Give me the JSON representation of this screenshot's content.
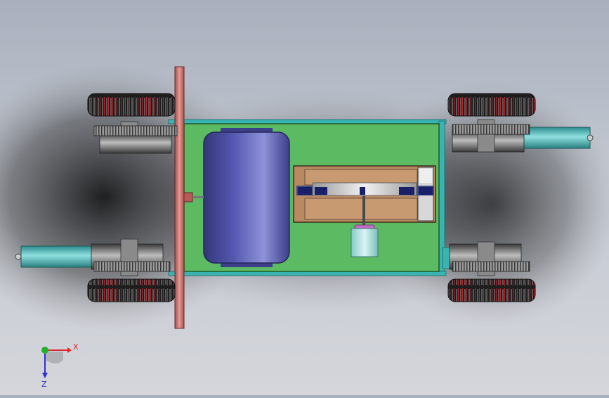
{
  "viewport": {
    "background_top": "#a9b0bd",
    "background_bottom": "#d4d6db"
  },
  "model": {
    "chassis_color": "#5cba62",
    "frame_color": "#3ab3b3",
    "tank_color": "#4a4d9e",
    "rod_color": "#d07a75",
    "tire_color": "#2a2a2a",
    "tire_tread_color": "#d0202a",
    "wood_color": "#b98a62"
  },
  "triad": {
    "x_label": "X",
    "z_label": "Z",
    "x_color": "#e0282a",
    "y_color": "#22b22a",
    "z_color": "#2a32d0",
    "icons": [
      "axis-triad-icon"
    ]
  }
}
